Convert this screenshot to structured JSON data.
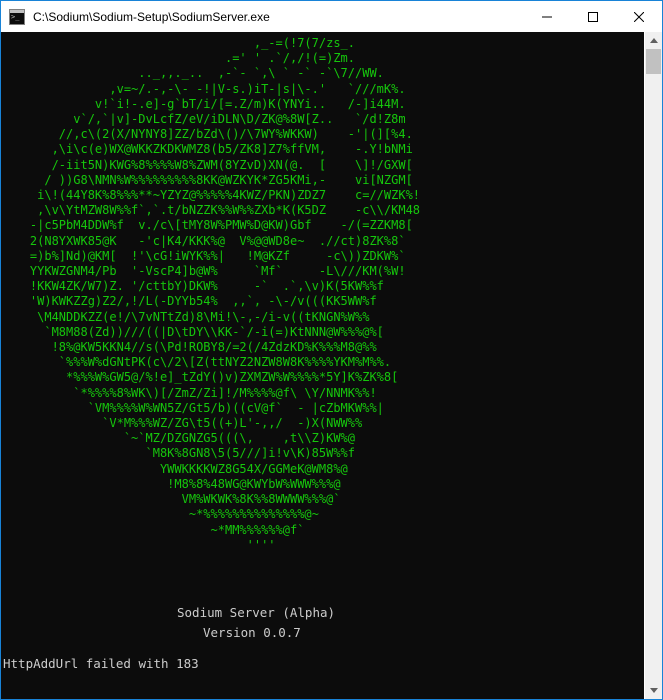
{
  "window": {
    "title": "C:\\Sodium\\Sodium-Setup\\SodiumServer.exe",
    "minimize_icon": "minimize-icon",
    "maximize_icon": "maximize-icon",
    "close_icon": "close-icon"
  },
  "console": {
    "ascii_art": [
      "                                   ,_-=(!7(7/zs_.",
      "                               .=' ' .`/,/!(=)Zm.",
      "                   .._,,._..  ,-`- `,\\ ` -` -`\\7//WW.",
      "               ,v=~/.-,-\\- -!|V-s.)iT-|s|\\-.'   `///mK%.",
      "             v!`i!-.e]-g`bT/i/[=.Z/m)K(YNYi..   /-]i44M.",
      "          v`/,`|v]-DvLcfZ/eV/iDLN\\D/ZK@%8W[Z..   `/d!Z8m",
      "        //,c\\(2(X/NYNY8]ZZ/bZd\\()/\\7WY%WKKW)    -'|(][%4.",
      "       ,\\i\\c(e)WX@WKKZKDKWMZ8(b5/ZK8]Z7%ffVM,    -.Y!bNMi",
      "       /-iit5N)KWG%8%%%%W8%ZWM(8YZvD)XN(@.  [    \\]!/GXW[",
      "      / ))G8\\NMN%W%%%%%%%%%8KK@WZKYK*ZG5KMi,-    vi[NZGM[",
      "     i\\!(44Y8K%8%%%**~YZYZ@%%%%%4KWZ/PKN)ZDZ7    c=//WZK%!",
      "     ,\\v\\YtMZW8W%%f`,`.t/bNZZK%%W%%ZXb*K(K5DZ    -c\\\\/KM48",
      "    -|c5PbM4DDW%f  v./c\\[tMY8W%PMW%D@KW)Gbf    -/(=ZZKM8[",
      "    2(N8YXWK85@K   -'c|K4/KKK%@  V%@@WD8e~  .//ct)8ZK%8`",
      "    =)b%]Nd)@KM[  !'\\cG!iWYK%%|   !M@KZf     -c\\))ZDKW%`",
      "    YYKWZGNM4/Pb  '-VscP4]b@W%     `Mf`     -L\\///KM(%W!",
      "    !KKW4ZK/W7)Z. '/cttbY)DKW%     -`  .`,\\v)K(5KW%%f",
      "    'W)KWKZZg)Z2/,!/L(-DYYb54%  ,,`, -\\-/v(((KK5WW%f",
      "     \\M4NDDKZZ(e!/\\7vNTtZd)8\\Mi!\\-,-/i-v((tKNGN%W%%",
      "      `M8M88(Zd))///((|D\\tDY\\\\KK-`/-i(=)KtNNN@W%%%@%[",
      "       !8%@KW5KKN4//s(\\Pd!ROBY8/=2(/4ZdzKD%K%%%M8@%%",
      "        `%%%W%dGNtPK(c\\/2\\[Z(ttNYZ2NZW8W8K%%%%YKM%M%%.",
      "         *%%%W%GW5@/%!e]_tZdY()v)ZXMZW%W%%%%*5Y]K%ZK%8[",
      "          `*%%%%8%WK\\)[/ZmZ/Zi]!/M%%%%@f\\ \\Y/NNMK%%!",
      "            `VM%%%%W%WN5Z/Gt5/b)((cV@f`  - |cZbMKW%%|",
      "              `V*M%%%WZ/ZG\\t5((+)L'-,,/  -)X(NWW%%",
      "                 `~`MZ/DZGNZG5(((\\,    ,t\\\\Z)KW%@",
      "                    `M8K%8GN8\\5(5///]i!v\\K)85W%%f",
      "                      YWWKKKKWZ8G54X/GGMeK@WM8%@",
      "                       !M8%8%48WG@KWYbW%WWW%%%@",
      "                         VM%WKWK%8K%%8WWWW%%%@`",
      "                          ~*%%%%%%%%%%%%%%@~",
      "                             ~*MM%%%%%%@f`",
      "                                  ''''"
    ],
    "server_name": "Sodium Server (Alpha)",
    "version": "Version 0.0.7",
    "error_message": "HttpAddUrl failed with 183"
  },
  "scrollbar": {
    "up_arrow_icon": "scroll-up-arrow-icon",
    "down_arrow_icon": "scroll-down-arrow-icon"
  }
}
